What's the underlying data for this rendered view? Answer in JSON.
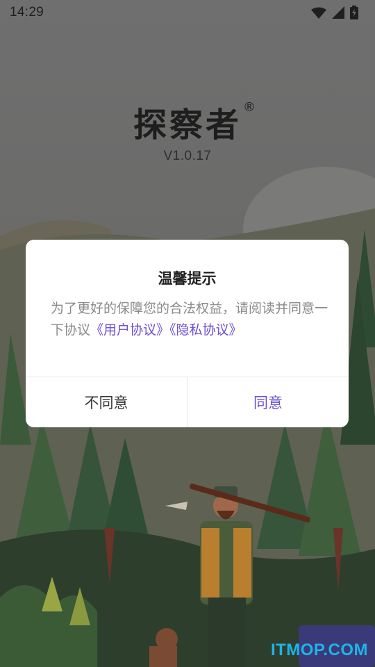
{
  "status_bar": {
    "time": "14:29",
    "icons": [
      "wifi-icon",
      "signal-icon",
      "battery-icon"
    ]
  },
  "app": {
    "logo_text": "探察者",
    "logo_registered_mark": "®",
    "version": "V1.0.17"
  },
  "dialog": {
    "title": "温馨提示",
    "body_prefix": "为了更好的保障您的合法权益，请阅读并同意一下协议",
    "user_agreement_link": "《用户协议》",
    "privacy_link": "《隐私协议》",
    "disagree_label": "不同意",
    "agree_label": "同意"
  },
  "watermark": "ITMOP.COM",
  "colors": {
    "accent": "#6a4fd3",
    "dialog_bg": "#ffffff",
    "watermark": "#1fb4e8"
  }
}
